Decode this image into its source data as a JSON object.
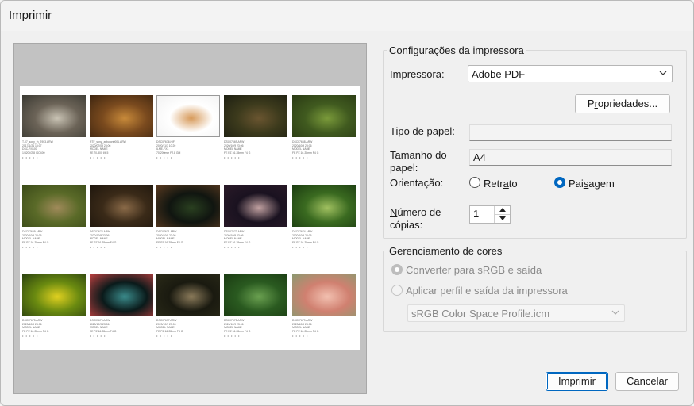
{
  "window": {
    "title": "Imprimir"
  },
  "printer_settings": {
    "group_label": "Configurações da impressora",
    "printer_label_pre": "Im",
    "printer_label_u": "p",
    "printer_label_post": "ressora:",
    "printer_value": "Adobe PDF",
    "properties_pre": "P",
    "properties_u": "r",
    "properties_post": "opriedades...",
    "paper_type_label": "Tipo de papel:",
    "paper_type_value": "",
    "paper_size_label_1": "Tamanho do",
    "paper_size_label_2": "papel:",
    "paper_size_value": "A4",
    "orientation_label": "Orientação:",
    "portrait_pre": "Retr",
    "portrait_u": "a",
    "portrait_post": "to",
    "landscape_pre": "Pai",
    "landscape_u": "s",
    "landscape_post": "agem",
    "orientation_selected": "landscape",
    "copies_label_u": "N",
    "copies_label_rest": "úmero de",
    "copies_label_2": "cópias:",
    "copies_value": "1"
  },
  "color_management": {
    "group_label": "Gerenciamento de cores",
    "convert_label": "Converter para sRGB e saída",
    "apply_label": "Aplicar perfil e saída da impressora",
    "profile_value": "sRGB Color Space Profile.icm"
  },
  "buttons": {
    "print": "Imprimir",
    "cancel": "Cancelar"
  },
  "thumbnails": [
    {
      "line1": "T-07_sony_th_2903.ARW",
      "line2": "2017/1/21 15:07",
      "line3": "DSC-RX100",
      "line4": "1/320 f/2.8 ISO400",
      "colors": [
        "#6b6357",
        "#c9c3b4",
        "#3b3a33"
      ]
    },
    {
      "line1": "RTF_sony_zebuton0001.ARW",
      "line2": "2020/07/09 23:06",
      "line3": "MODEL NAME",
      "line4": "FE 70-300 f/4.5",
      "colors": [
        "#7a4a1e",
        "#c88a3a",
        "#3d2510"
      ]
    },
    {
      "line1": "DSC07676.HIF",
      "line2": "2020/11/3 10:20",
      "line3": "ILME-FX3",
      "line4": "70-200mm F2.8 GM",
      "colors": [
        "#ffffff",
        "#d79a5a",
        "#f2f2f2"
      ]
    },
    {
      "line1": "DSC07669.ARW",
      "line2": "2020/10/9 23:06",
      "line3": "MODEL NAME",
      "line4": "FE PZ 16-35mm F4 G",
      "colors": [
        "#3c3a1c",
        "#6a5530",
        "#1d1f12"
      ]
    },
    {
      "line1": "DSC07668.ARW",
      "line2": "2020/10/9 23:06",
      "line3": "MODEL NAME",
      "line4": "FE PZ 16-35mm F4 G",
      "colors": [
        "#405a1f",
        "#7a9a3a",
        "#2a3a14"
      ]
    },
    {
      "line1": "DSC07669.ARW",
      "line2": "2020/10/9 23:06",
      "line3": "MODEL NAME",
      "line4": "FE PZ 16-35mm F4 G",
      "colors": [
        "#5a6a28",
        "#a08a5a",
        "#3a4a18"
      ]
    },
    {
      "line1": "DSC07672.ARW",
      "line2": "2020/10/9 23:06",
      "line3": "MODEL NAME",
      "line4": "FE PZ 16-35mm F4 G",
      "colors": [
        "#3a2a18",
        "#8a6a48",
        "#1e160d"
      ]
    },
    {
      "line1": "DSC07671.ARW",
      "line2": "2020/10/9 23:06",
      "line3": "MODEL NAME",
      "line4": "FE PZ 16-35mm F4 G",
      "colors": [
        "#101510",
        "#2a4020",
        "#5a3a20"
      ]
    },
    {
      "line1": "DSC07673.ARW",
      "line2": "2020/10/9 23:06",
      "line3": "MODEL NAME",
      "line4": "FE PZ 16-35mm F4 G",
      "colors": [
        "#1a1220",
        "#c0a0a0",
        "#2a1a28"
      ]
    },
    {
      "line1": "DSC07674.ARW",
      "line2": "2020/10/9 23:06",
      "line3": "MODEL NAME",
      "line4": "FE PZ 16-35mm F4 G",
      "colors": [
        "#3a6a20",
        "#a0c060",
        "#1a3a10"
      ]
    },
    {
      "line1": "DSC07675.ARW",
      "line2": "2020/10/9 23:06",
      "line3": "MODEL NAME",
      "line4": "FE PZ 16-35mm F4 G",
      "colors": [
        "#6a8a10",
        "#e0d020",
        "#2a4010"
      ]
    },
    {
      "line1": "DSC07676.ARW",
      "line2": "2020/10/9 23:06",
      "line3": "MODEL NAME",
      "line4": "FE PZ 16-35mm F4 G",
      "colors": [
        "#0a1a1a",
        "#3a8a8a",
        "#c04040"
      ]
    },
    {
      "line1": "DSC07677.ARW",
      "line2": "2020/10/9 23:06",
      "line3": "MODEL NAME",
      "line4": "FE PZ 16-35mm F4 G",
      "colors": [
        "#1a1a10",
        "#8a7a5a",
        "#2a2a18"
      ]
    },
    {
      "line1": "DSC07678.ARW",
      "line2": "2020/10/9 23:06",
      "line3": "MODEL NAME",
      "line4": "FE PZ 16-35mm F4 G",
      "colors": [
        "#2a5a20",
        "#6aa050",
        "#1a3a12"
      ]
    },
    {
      "line1": "DSC07679.ARW",
      "line2": "2020/10/9 23:06",
      "line3": "MODEL NAME",
      "line4": "FE PZ 16-35mm F4 G",
      "colors": [
        "#d08070",
        "#f2c0b0",
        "#8a9a70"
      ]
    }
  ]
}
